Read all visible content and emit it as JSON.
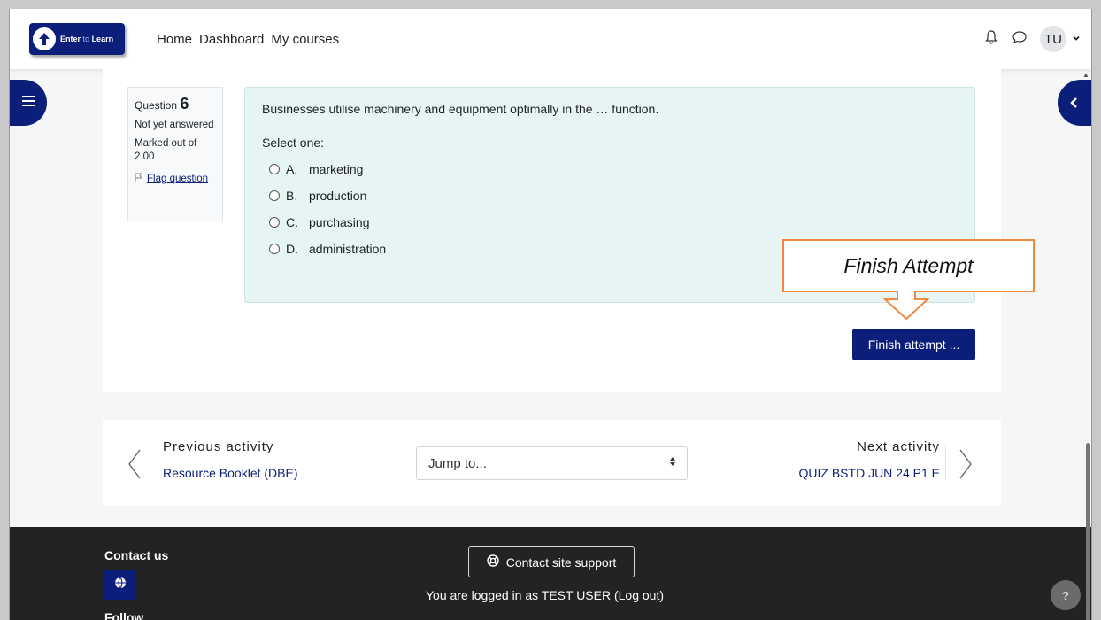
{
  "brand": {
    "logo_text_a": "Enter",
    "logo_text_b": "to",
    "logo_text_c": "Learn"
  },
  "nav": {
    "links": [
      "Home",
      "Dashboard",
      "My courses"
    ],
    "user_initials": "TU"
  },
  "question": {
    "label": "Question",
    "number": "6",
    "status": "Not yet answered",
    "marks": "Marked out of 2.00",
    "flag": "Flag question",
    "text": "Businesses utilise machinery and equipment optimally in the … function.",
    "prompt": "Select one:",
    "answers": [
      {
        "letter": "A.",
        "text": "marketing"
      },
      {
        "letter": "B.",
        "text": "production"
      },
      {
        "letter": "C.",
        "text": "purchasing"
      },
      {
        "letter": "D.",
        "text": "administration"
      }
    ]
  },
  "finish_button": "Finish attempt ...",
  "callout": "Finish Attempt",
  "activity_nav": {
    "previous_label": "Previous activity",
    "previous_link": "Resource Booklet (DBE)",
    "jump_placeholder": "Jump to...",
    "next_label": "Next activity",
    "next_link": "QUIZ BSTD JUN 24 P1 E"
  },
  "footer": {
    "contact_heading": "Contact us",
    "support_button": "Contact site support",
    "logged_in_text": "You are logged in as TEST USER (Log out)",
    "follow_heading": "Follow",
    "help": "?"
  },
  "colors": {
    "brand_navy": "#0b1e7a",
    "question_bg": "#e6f4f4",
    "callout_border": "#f0883e",
    "footer_bg": "#232323"
  }
}
